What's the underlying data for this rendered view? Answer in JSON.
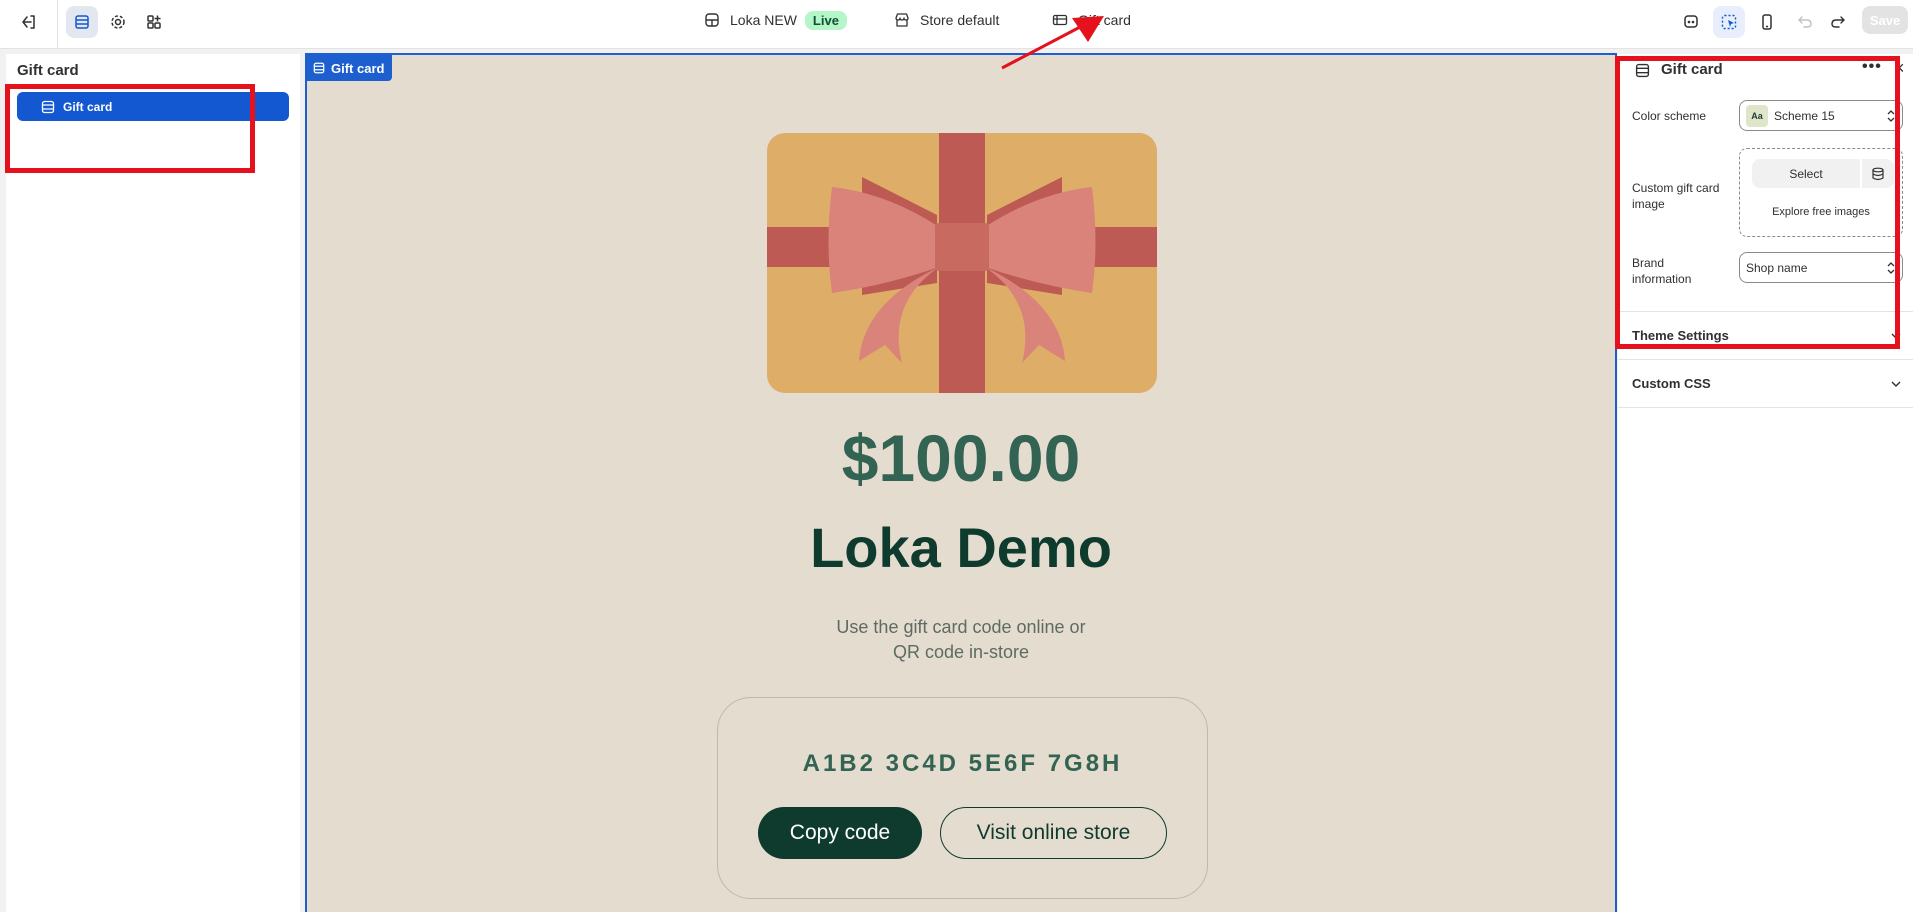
{
  "topbar": {
    "theme_name": "Loka NEW",
    "live_badge": "Live",
    "store": "Store default",
    "template": "Gift card",
    "save_label": "Save"
  },
  "sidebar": {
    "title": "Gift card",
    "items": [
      {
        "label": "Gift card"
      }
    ]
  },
  "preview": {
    "section_tag": "Gift card",
    "amount": "$100.00",
    "shop_name": "Loka Demo",
    "subtitle_line1": "Use the gift card code online or",
    "subtitle_line2": "QR code in-store",
    "code": "A1B2 3C4D 5E6F 7G8H",
    "copy_button": "Copy code",
    "visit_button": "Visit online store"
  },
  "settings": {
    "title": "Gift card",
    "color_scheme": {
      "label": "Color scheme",
      "swatch_text": "Aa",
      "value": "Scheme 15"
    },
    "custom_image": {
      "label_line1": "Custom gift card",
      "label_line2": "image",
      "select_label": "Select",
      "explore_label": "Explore free images"
    },
    "brand_info": {
      "label_line1": "Brand",
      "label_line2": "information",
      "value": "Shop name"
    },
    "sections": [
      {
        "label": "Theme Settings"
      },
      {
        "label": "Custom CSS"
      }
    ]
  },
  "colors": {
    "accent": "#1357d1",
    "annotation_red": "#e5121e",
    "preview_bg": "#e4dccf",
    "dark_green": "#0f3b2e"
  },
  "icons": [
    "exit-icon",
    "sections-icon",
    "gear-icon",
    "apps-icon",
    "theme-icon",
    "store-icon",
    "gift-card-icon",
    "inspector-icon",
    "cursor-icon",
    "mobile-icon",
    "undo-icon",
    "redo-icon",
    "more-icon",
    "close-icon",
    "database-icon",
    "chevron-down-icon",
    "select-arrows-icon"
  ]
}
